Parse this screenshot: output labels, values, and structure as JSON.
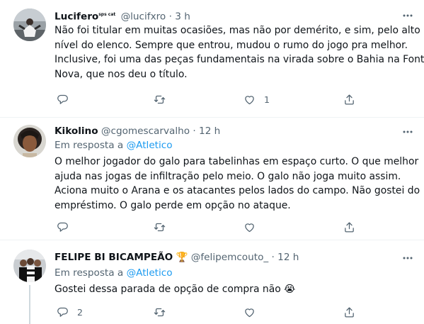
{
  "tweets": [
    {
      "display_name": "Lucifero",
      "name_suffix": "sps cat",
      "handle": "@lucifxro",
      "separator": "·",
      "time": "3 h",
      "reply_prefix": "",
      "reply_mention": "",
      "text_lines": [
        "Não foi titular em muitas ocasiões, mas não por demérito, e sim, pelo alto",
        "nível do elenco. Sempre que entrou, mudou o rumo do jogo pra melhor.",
        "Inclusive, foi uma das peças fundamentais na virada sobre o Bahia na Fonte",
        "Nova, que nos deu o título."
      ],
      "reply_count": "",
      "retweet_count": "",
      "like_count": "1"
    },
    {
      "display_name": "Kikolino",
      "name_suffix": "",
      "handle": "@cgomescarvalho",
      "separator": "·",
      "time": "12 h",
      "reply_prefix": "Em resposta a",
      "reply_mention": "@Atletico",
      "text_lines": [
        "O melhor jogador do galo para tabelinhas em espaço curto. O que melhor",
        "ajuda nas jogas de infiltração pelo meio. O galo não joga muito assim.",
        "Aciona muito o Arana e os atacantes pelos lados do campo. Não gostei do",
        "empréstimo. O galo perde em opção no ataque."
      ],
      "reply_count": "",
      "retweet_count": "",
      "like_count": ""
    },
    {
      "display_name": "FELIPE BI BICAMPEÃO",
      "name_emoji": "🏆",
      "name_suffix": "",
      "handle": "@felipemcouto_",
      "separator": "·",
      "time": "12 h",
      "reply_prefix": "Em resposta a",
      "reply_mention": "@Atletico",
      "text_lines": [
        "Gostei dessa parada de opção de compra não 😭"
      ],
      "reply_count": "2",
      "retweet_count": "",
      "like_count": ""
    }
  ],
  "icons": [
    "more-icon",
    "reply-icon",
    "retweet-icon",
    "like-icon",
    "share-icon"
  ],
  "colors": {
    "text": "#0f1419",
    "secondary": "#536471",
    "link": "#1d9bf0",
    "divider": "#eff3f4",
    "thread_line": "#cfd9de"
  }
}
